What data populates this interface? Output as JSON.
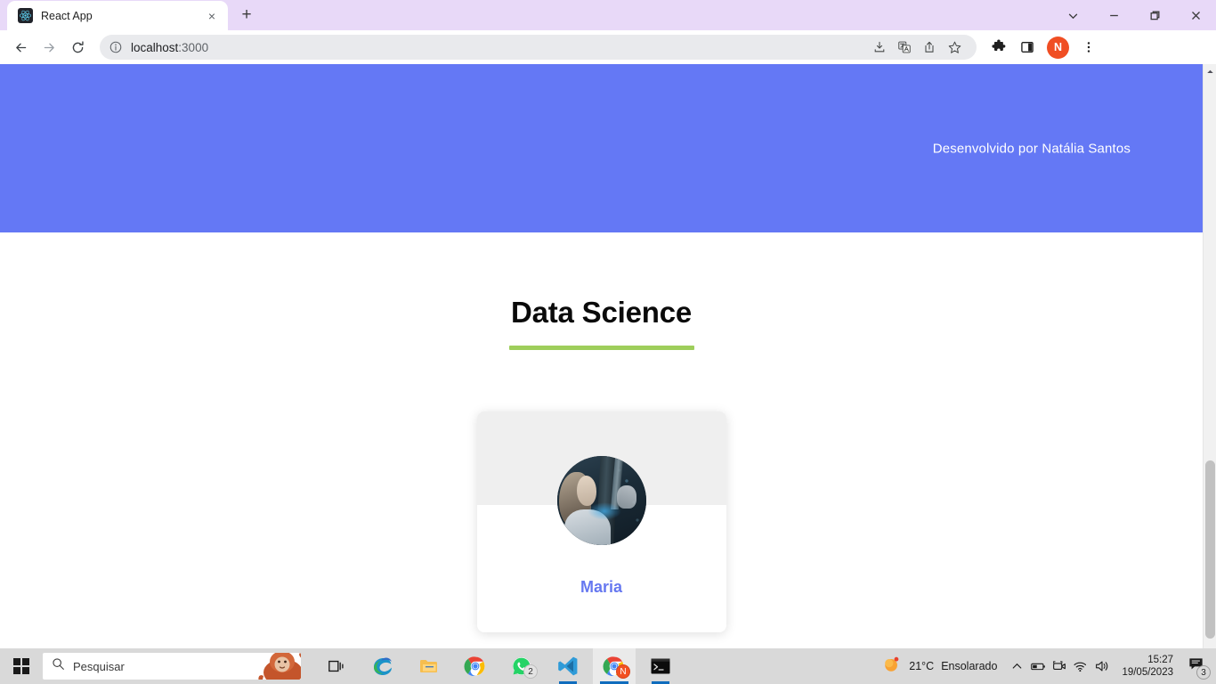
{
  "browser": {
    "tab": {
      "title": "React App",
      "favicon": "react-logo-icon",
      "close": "×"
    },
    "new_tab_label": "+",
    "window_controls": {
      "tab_search": "tab-search-icon",
      "minimize": "minimize-icon",
      "maximize": "maximize-icon",
      "close": "close-icon"
    },
    "nav": {
      "back": "back-arrow-icon",
      "forward": "forward-arrow-icon",
      "reload": "reload-icon"
    },
    "omnibox": {
      "site_info_icon": "info-circle-icon",
      "host": "localhost",
      "port": ":3000",
      "full_url": "localhost:3000",
      "actions": [
        "install-icon",
        "translate-icon",
        "share-icon",
        "bookmark-star-icon"
      ]
    },
    "toolbar_right": {
      "extensions": "puzzle-piece-icon",
      "side_panel": "side-panel-icon",
      "profile_initial": "N",
      "profile_color": "#F04E23",
      "menu": "three-dot-menu-icon"
    }
  },
  "page": {
    "hero": {
      "credit": "Desenvolvido por Natália Santos",
      "background_color": "#6478F5"
    },
    "section": {
      "title": "Data Science",
      "underline_color": "#9ECE5B"
    },
    "cards": [
      {
        "name": "Maria",
        "name_color": "#6678F0",
        "avatar_alt": "woman-touching-screen-photo",
        "banner_color": "#EFEFEF"
      }
    ]
  },
  "scrollbar": {
    "up_arrow": "scroll-up-arrow-icon",
    "down_arrow": "scroll-down-arrow-icon"
  },
  "taskbar": {
    "start": "windows-start-icon",
    "search": {
      "placeholder": "Pesquisar",
      "icon": "search-icon",
      "mascot": "orangutan-mascot"
    },
    "task_view": "task-view-icon",
    "apps": [
      {
        "name": "edge-icon",
        "badge": ""
      },
      {
        "name": "file-explorer-icon",
        "badge": ""
      },
      {
        "name": "chrome-icon",
        "badge": ""
      },
      {
        "name": "whatsapp-icon",
        "badge": "2"
      },
      {
        "name": "vscode-icon",
        "badge": ""
      },
      {
        "name": "chrome-profile-icon",
        "badge": "N"
      },
      {
        "name": "terminal-icon",
        "badge": ""
      }
    ],
    "tray": {
      "weather_icon": "sun-icon",
      "temperature": "21°C",
      "condition": "Ensolarado",
      "overflow": "chevron-up-icon",
      "battery": "battery-icon",
      "meet": "camera-icon",
      "wifi": "wifi-icon",
      "volume": "volume-icon",
      "time": "15:27",
      "date": "19/05/2023",
      "notifications_icon": "notification-icon",
      "notifications_count": "3"
    }
  }
}
